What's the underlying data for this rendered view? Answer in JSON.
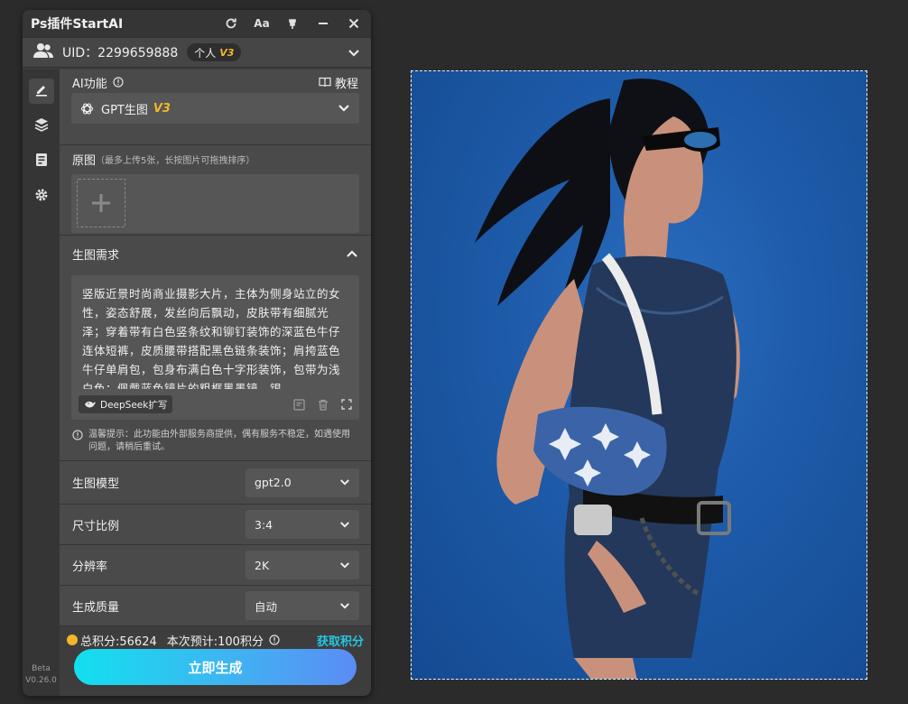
{
  "app": {
    "title": "Ps插件StartAI"
  },
  "user": {
    "uid": "UID：2299659888",
    "badge_label": "个人",
    "badge_version": "V3"
  },
  "sidebar": {
    "beta": "Beta",
    "version": "V0.26.0"
  },
  "ai_function": {
    "label": "AI功能",
    "tutorial": "教程",
    "selected": "GPT生图",
    "selected_version": "V3"
  },
  "original": {
    "label": "原图",
    "hint": "（最多上传5张，长按图片可拖拽排序）"
  },
  "requirement": {
    "label": "生图需求",
    "prompt": "竖版近景时尚商业摄影大片，主体为侧身站立的女性，姿态舒展，发丝向后飘动，皮肤带有细腻光泽；穿着带有白色竖条纹和铆钉装饰的深蓝色牛仔连体短裤，皮质腰带搭配黑色链条装饰；肩挎蓝色牛仔单肩包，包身布满白色十字形装饰，包带为浅白色；佩戴蓝色镜片的粗框黑墨镜，银",
    "deepseek": "DeepSeek扩写",
    "notice": "温馨提示：此功能由外部服务商提供，偶有服务不稳定，如遇使用问题，请稍后重试。"
  },
  "settings": {
    "model_label": "生图模型",
    "model_value": "gpt2.0",
    "ratio_label": "尺寸比例",
    "ratio_value": "3:4",
    "resolution_label": "分辨率",
    "resolution_value": "2K",
    "quality_label": "生成质量",
    "quality_value": "自动"
  },
  "points": {
    "total": "总积分:56624",
    "estimate": "本次预计:100积分",
    "get": "获取积分"
  },
  "generate": {
    "label": "立即生成"
  },
  "colors": {
    "accent_cyan": "#12e0ee",
    "accent_blue": "#5b8cf4",
    "version_gold": "#f3b62b",
    "link": "#27c5e2"
  }
}
